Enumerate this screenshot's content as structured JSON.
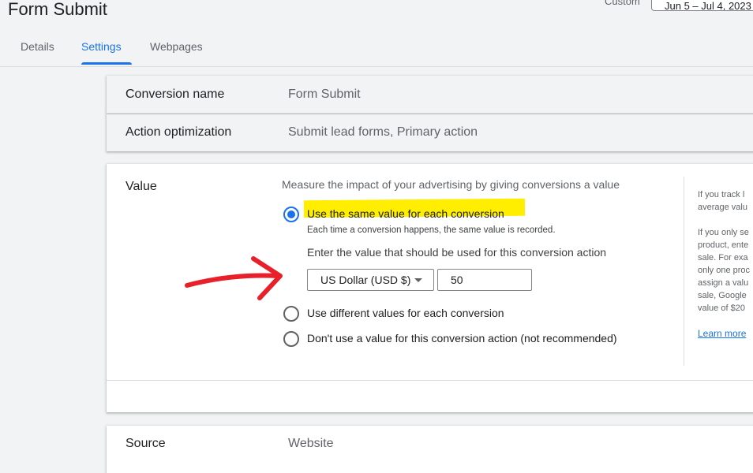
{
  "header": {
    "title": "Form Submit",
    "date_range_label": "Custom",
    "date_range_value": "Jun 5 – Jul 4, 2023"
  },
  "tabs": [
    {
      "label": "Details",
      "active": false
    },
    {
      "label": "Settings",
      "active": true
    },
    {
      "label": "Webpages",
      "active": false
    }
  ],
  "summary": {
    "conversion_name_label": "Conversion name",
    "conversion_name_value": "Form Submit",
    "action_optimization_label": "Action optimization",
    "action_optimization_value": "Submit lead forms, Primary action"
  },
  "value_section": {
    "title": "Value",
    "description": "Measure the impact of your advertising by giving conversions a value",
    "options": [
      {
        "label": "Use the same value for each conversion",
        "selected": true
      },
      {
        "label": "Use different values for each conversion",
        "selected": false
      },
      {
        "label": "Don't use a value for this conversion action (not recommended)",
        "selected": false
      }
    ],
    "same_value_subtext": "Each time a conversion happens, the same value is recorded.",
    "enter_value_label": "Enter the value that should be used for this conversion action",
    "currency": "US Dollar (USD $)",
    "amount": "50",
    "help_lines": [
      "If you track l",
      "average valu",
      "If you only se",
      "product, ente",
      "sale. For exa",
      "only one proc",
      "assign a valu",
      "sale, Google",
      "value of $20"
    ],
    "learn_more": "Learn more"
  },
  "source": {
    "label": "Source",
    "value": "Website"
  },
  "colors": {
    "accent": "#1a73e8",
    "highlight": "#ffee00",
    "annotation_arrow": "#e8202a"
  }
}
